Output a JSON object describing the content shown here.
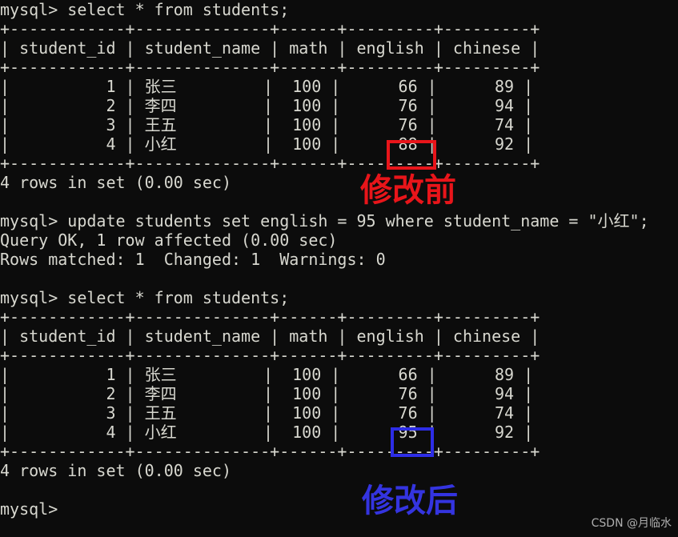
{
  "terminal": {
    "background_color": "#0c0c0c",
    "text_color": "#d8d8d0",
    "prompt": "mysql>",
    "lines": [
      "mysql> select * from students;",
      "+------------+--------------+------+---------+---------+",
      "| student_id | student_name | math | english | chinese |",
      "+------------+--------------+------+---------+---------+",
      "|          1 | 张三         |  100 |      66 |      89 |",
      "|          2 | 李四         |  100 |      76 |      94 |",
      "|          3 | 王五         |  100 |      76 |      74 |",
      "|          4 | 小红         |  100 |      88 |      92 |",
      "+------------+--------------+------+---------+---------+",
      "4 rows in set (0.00 sec)",
      "",
      "mysql> update students set english = 95 where student_name = \"小红\";",
      "Query OK, 1 row affected (0.00 sec)",
      "Rows matched: 1  Changed: 1  Warnings: 0",
      "",
      "mysql> select * from students;",
      "+------------+--------------+------+---------+---------+",
      "| student_id | student_name | math | english | chinese |",
      "+------------+--------------+------+---------+---------+",
      "|          1 | 张三         |  100 |      66 |      89 |",
      "|          2 | 李四         |  100 |      76 |      94 |",
      "|          3 | 王五         |  100 |      76 |      74 |",
      "|          4 | 小红         |  100 |      95 |      92 |",
      "+------------+--------------+------+---------+---------+",
      "4 rows in set (0.00 sec)",
      "",
      "mysql>"
    ]
  },
  "queries": {
    "select_before": "mysql> select * from students;",
    "update_statement": "mysql> update students set english = 95 where student_name = \"小红\";",
    "query_ok": "Query OK, 1 row affected (0.00 sec)",
    "rows_matched": "Rows matched: 1  Changed: 1  Warnings: 0",
    "select_after": "mysql> select * from students;",
    "rows_in_set_before": "4 rows in set (0.00 sec)",
    "rows_in_set_after": "4 rows in set (0.00 sec)",
    "final_prompt": "mysql>"
  },
  "table_before": {
    "headers": [
      "student_id",
      "student_name",
      "math",
      "english",
      "chinese"
    ],
    "rows": [
      [
        "1",
        "张三",
        "100",
        "66",
        "89"
      ],
      [
        "2",
        "李四",
        "100",
        "76",
        "94"
      ],
      [
        "3",
        "王五",
        "100",
        "76",
        "74"
      ],
      [
        "4",
        "小红",
        "100",
        "88",
        "92"
      ]
    ],
    "row_count_text": "4 rows in set (0.00 sec)"
  },
  "table_after": {
    "headers": [
      "student_id",
      "student_name",
      "math",
      "english",
      "chinese"
    ],
    "rows": [
      [
        "1",
        "张三",
        "100",
        "66",
        "89"
      ],
      [
        "2",
        "李四",
        "100",
        "76",
        "94"
      ],
      [
        "3",
        "王五",
        "100",
        "76",
        "74"
      ],
      [
        "4",
        "小红",
        "100",
        "95",
        "92"
      ]
    ],
    "row_count_text": "4 rows in set (0.00 sec)"
  },
  "annotations": {
    "before_label": "修改前",
    "before_color": "#e8151a",
    "before_highlight_value": "88",
    "after_label": "修改后",
    "after_color": "#3434e0",
    "after_highlight_value": "95"
  },
  "watermark": {
    "text": "CSDN @月临水"
  }
}
